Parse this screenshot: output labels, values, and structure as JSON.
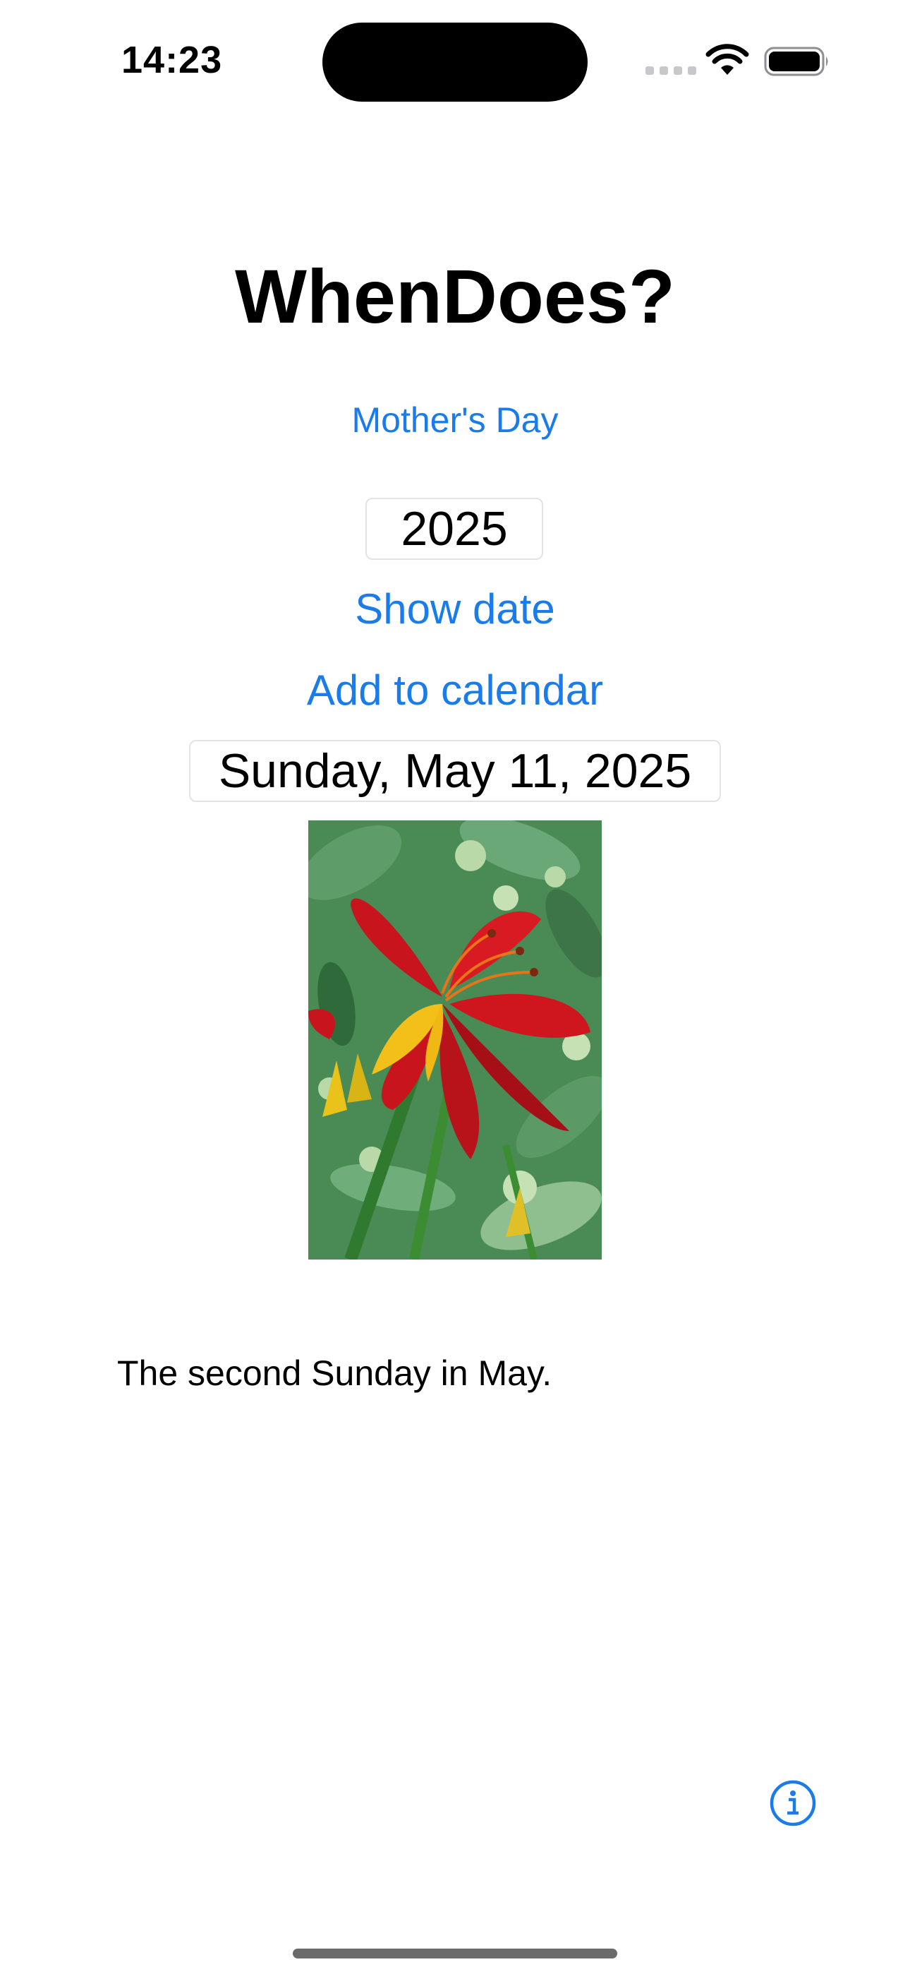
{
  "status_bar": {
    "time": "14:23"
  },
  "app": {
    "title": "WhenDoes?"
  },
  "holiday": {
    "name": "Mother's Day"
  },
  "year_input": {
    "value": "2025"
  },
  "actions": {
    "show_date_label": "Show date",
    "add_calendar_label": "Add to calendar"
  },
  "result": {
    "date_text": "Sunday, May 11, 2025",
    "description": "The second Sunday in May."
  },
  "colors": {
    "accent": "#1a7bea"
  },
  "icons": {
    "info": "info-icon",
    "wifi": "wifi-icon",
    "battery": "battery-icon"
  }
}
